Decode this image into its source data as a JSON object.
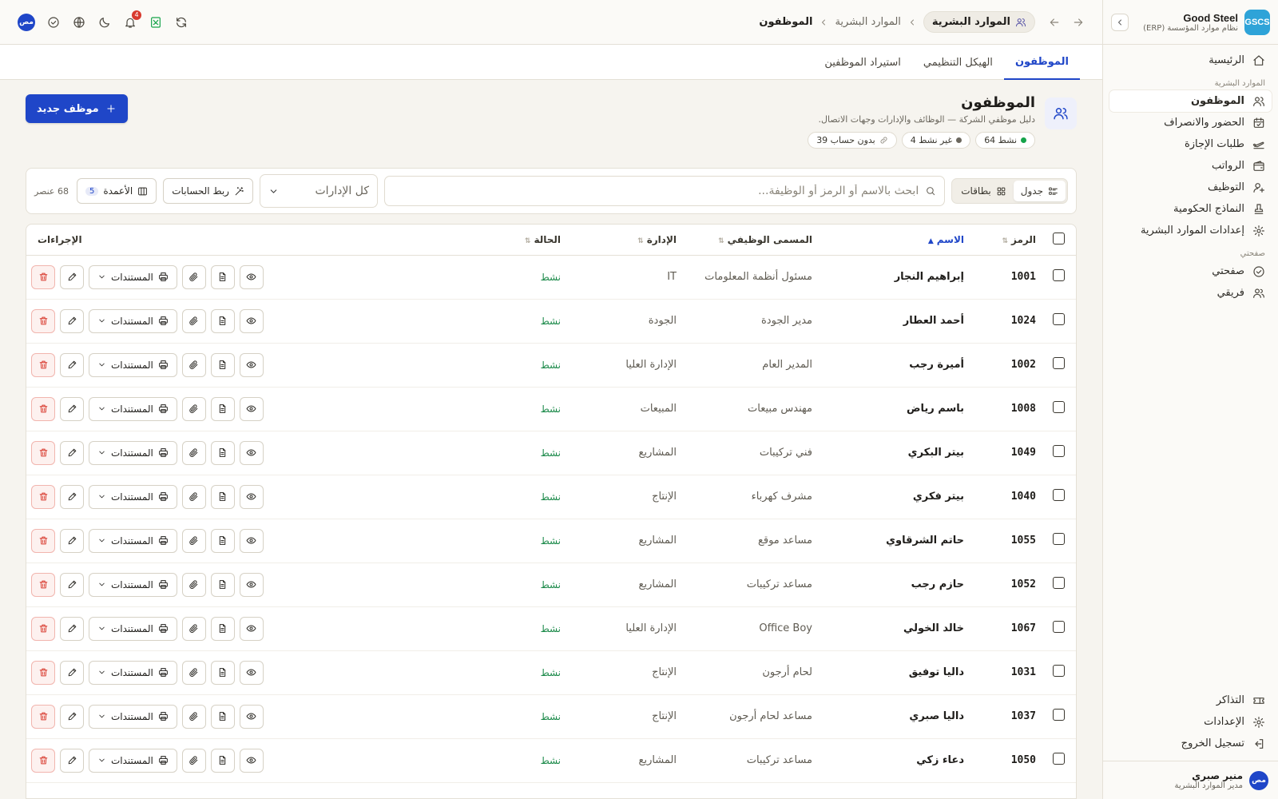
{
  "brand": {
    "logo": "GSCS",
    "name": "Good Steel",
    "subtitle": "نظام موارد المؤسسة (ERP)"
  },
  "sidebar": {
    "home": "الرئيسية",
    "hr_section": "الموارد البشرية",
    "hr_items": [
      {
        "label": "الموظفون",
        "icon": "users-icon"
      },
      {
        "label": "الحضور والانصراف",
        "icon": "calendar-check-icon"
      },
      {
        "label": "طلبات الإجازة",
        "icon": "plane-icon"
      },
      {
        "label": "الرواتب",
        "icon": "wallet-icon"
      },
      {
        "label": "التوظيف",
        "icon": "user-plus-icon"
      },
      {
        "label": "النماذج الحكومية",
        "icon": "stamp-icon"
      },
      {
        "label": "إعدادات الموارد البشرية",
        "icon": "gear-icon"
      }
    ],
    "my_section": "صفحتي",
    "my_items": [
      {
        "label": "صفحتي",
        "icon": "check-circle-icon"
      },
      {
        "label": "فريقي",
        "icon": "team-icon"
      }
    ],
    "bottom_items": [
      {
        "label": "التذاكر",
        "icon": "ticket-icon"
      },
      {
        "label": "الإعدادات",
        "icon": "gear-icon"
      },
      {
        "label": "تسجيل الخروج",
        "icon": "logout-icon"
      }
    ],
    "user": {
      "initials": "مص",
      "name": "منير صبري",
      "role": "مدير الموارد البشرية"
    }
  },
  "topbar": {
    "crumb_chip": "الموارد البشرية",
    "crumb_middle": "الموارد البشرية",
    "crumb_current": "الموظفون",
    "notification_count": "4",
    "avatar_initials": "مص"
  },
  "tabs": [
    "الموظفون",
    "الهيكل التنظيمي",
    "استيراد الموظفين"
  ],
  "page": {
    "title": "الموظفون",
    "subtitle": "دليل موظفي الشركة — الوظائف والإدارات وجهات الاتصال.",
    "pills": [
      {
        "label": "نشط 64",
        "color": "#16a34a"
      },
      {
        "label": "غير نشط 4",
        "color": "#6b675e"
      },
      {
        "label": "بدون حساب 39",
        "color": ""
      }
    ],
    "new_button": "موظف جديد"
  },
  "toolbar": {
    "view_table": "جدول",
    "view_cards": "بطاقات",
    "search_placeholder": "ابحث بالاسم أو الرمز أو الوظيفة...",
    "department_select": "كل الإدارات",
    "link_accounts": "ربط الحسابات",
    "columns": "الأعمدة",
    "columns_count": "5",
    "row_count": "68 عنصر"
  },
  "table": {
    "headers": {
      "code": "الرمز",
      "name": "الاسم",
      "title": "المسمى الوظيفي",
      "department": "الإدارة",
      "status": "الحالة",
      "actions": "الإجراءات"
    },
    "documents_label": "المستندات",
    "rows": [
      {
        "code": "1001",
        "name": "إبراهيم النجار",
        "title": "مسئول أنظمة المعلومات",
        "department": "IT",
        "status": "نشط"
      },
      {
        "code": "1024",
        "name": "أحمد العطار",
        "title": "مدير الجودة",
        "department": "الجودة",
        "status": "نشط"
      },
      {
        "code": "1002",
        "name": "أميرة رجب",
        "title": "المدير العام",
        "department": "الإدارة العليا",
        "status": "نشط"
      },
      {
        "code": "1008",
        "name": "باسم رياض",
        "title": "مهندس مبيعات",
        "department": "المبيعات",
        "status": "نشط"
      },
      {
        "code": "1049",
        "name": "بيتر البكري",
        "title": "فني تركيبات",
        "department": "المشاريع",
        "status": "نشط"
      },
      {
        "code": "1040",
        "name": "بيتر فكري",
        "title": "مشرف كهرباء",
        "department": "الإنتاج",
        "status": "نشط"
      },
      {
        "code": "1055",
        "name": "حاتم الشرقاوي",
        "title": "مساعد موقع",
        "department": "المشاريع",
        "status": "نشط"
      },
      {
        "code": "1052",
        "name": "حازم رجب",
        "title": "مساعد تركيبات",
        "department": "المشاريع",
        "status": "نشط"
      },
      {
        "code": "1067",
        "name": "خالد الخولي",
        "title": "Office Boy",
        "department": "الإدارة العليا",
        "status": "نشط"
      },
      {
        "code": "1031",
        "name": "داليا توفيق",
        "title": "لحام أرجون",
        "department": "الإنتاج",
        "status": "نشط"
      },
      {
        "code": "1037",
        "name": "داليا صبري",
        "title": "مساعد لحام أرجون",
        "department": "الإنتاج",
        "status": "نشط"
      },
      {
        "code": "1050",
        "name": "دعاء زكي",
        "title": "مساعد تركيبات",
        "department": "المشاريع",
        "status": "نشط"
      }
    ]
  },
  "colors": {
    "accent": "#1f46c8",
    "active_status": "#1c8a4a",
    "danger": "#d83a2e",
    "logo_bg": "#2ea3d8"
  }
}
